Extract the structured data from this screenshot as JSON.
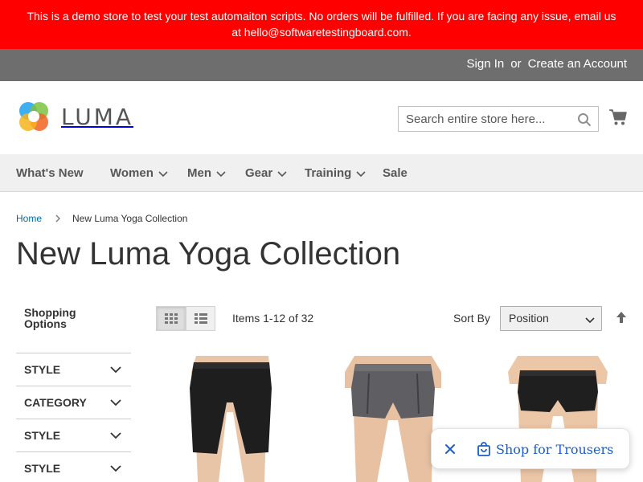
{
  "banner": {
    "text": "This is a demo store to test your test automaiton scripts. No orders will be fulfilled. If you are facing any issue, email us at",
    "email": "hello@softwaretestingboard.com."
  },
  "panel": {
    "sign_in": "Sign In",
    "or": "or",
    "create_account": "Create an Account"
  },
  "header": {
    "logo_text": "LUMA",
    "logo_icon": "luma-logo-icon",
    "search_placeholder": "Search entire store here...",
    "search_icon": "search-icon",
    "cart_icon": "cart-icon"
  },
  "nav": {
    "items": [
      {
        "label": "What's New",
        "has_dropdown": false
      },
      {
        "label": "Women",
        "has_dropdown": true
      },
      {
        "label": "Men",
        "has_dropdown": true
      },
      {
        "label": "Gear",
        "has_dropdown": true
      },
      {
        "label": "Training",
        "has_dropdown": true
      },
      {
        "label": "Sale",
        "has_dropdown": false
      }
    ]
  },
  "breadcrumb": {
    "home": "Home",
    "current": "New Luma Yoga Collection"
  },
  "page_title": "New Luma Yoga Collection",
  "sidebar": {
    "title": "Shopping Options",
    "filters": [
      "STYLE",
      "CATEGORY",
      "STYLE",
      "STYLE"
    ]
  },
  "toolbar": {
    "view_modes": [
      "grid",
      "list"
    ],
    "active_mode": "grid",
    "amount": "Items 1-12 of 32",
    "sort_label": "Sort By",
    "sort_value": "Position",
    "sort_direction_icon": "sort-arrow-up-icon"
  },
  "products": [
    {
      "image": "black-bike-shorts-photo"
    },
    {
      "image": "grey-yoga-shorts-photo"
    },
    {
      "image": "black-yoga-shorts-photo"
    }
  ],
  "toast": {
    "label": "Shop for Trousers",
    "close_icon": "close-icon",
    "bag_icon": "shopping-bag-icon"
  },
  "colors": {
    "banner": "#ff0000",
    "panel": "#6e6e6e",
    "nav": "#f0f0f0",
    "link": "#006bb4",
    "toast_text": "#1a5ec9"
  }
}
